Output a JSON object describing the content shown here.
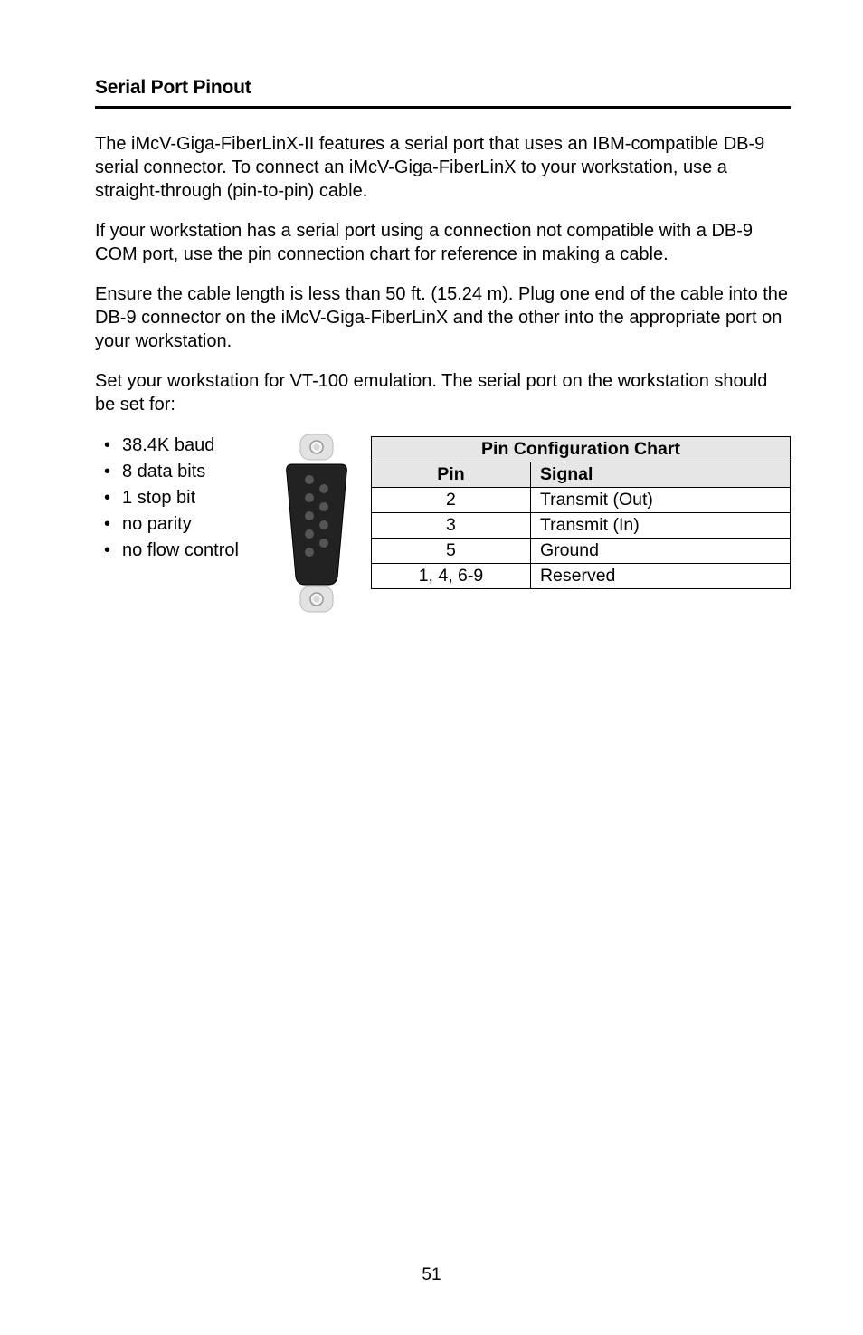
{
  "title": "Serial Port Pinout",
  "paragraphs": {
    "p1": "The iMcV-Giga-FiberLinX-II features a serial port that uses an IBM-compatible DB-9 serial connector.  To connect an iMcV-Giga-FiberLinX to your workstation, use a straight-through (pin-to-pin) cable.",
    "p2": "If your workstation has a serial port using a connection not compatible with a DB-9 COM port, use the pin connection chart for reference in making a cable.",
    "p3": "Ensure the cable length is less than 50 ft. (15.24 m).  Plug one end of the cable into the DB-9 connector on the iMcV-Giga-FiberLinX and the other into the appropriate port on your workstation.",
    "p4": "Set your workstation for VT-100 emulation.  The serial port on the workstation should be set for:"
  },
  "bullets": {
    "b1": "38.4K baud",
    "b2": "8 data bits",
    "b3": "1 stop bit",
    "b4": "no parity",
    "b5": "no flow control"
  },
  "chart_data": {
    "type": "table",
    "title": "Pin Configuration Chart",
    "columns": [
      "Pin",
      "Signal"
    ],
    "rows": [
      {
        "pin": "2",
        "signal": "Transmit (Out)"
      },
      {
        "pin": "3",
        "signal": "Transmit (In)"
      },
      {
        "pin": "5",
        "signal": "Ground"
      },
      {
        "pin": "1, 4, 6-9",
        "signal": "Reserved"
      }
    ]
  },
  "table": {
    "header": "Pin Configuration Chart",
    "col1": "Pin",
    "col2": "Signal",
    "r1c1": "2",
    "r1c2": "Transmit (Out)",
    "r2c1": "3",
    "r2c2": "Transmit (In)",
    "r3c1": "5",
    "r3c2": "Ground",
    "r4c1": "1, 4, 6-9",
    "r4c2": "Reserved"
  },
  "pageNumber": "51"
}
